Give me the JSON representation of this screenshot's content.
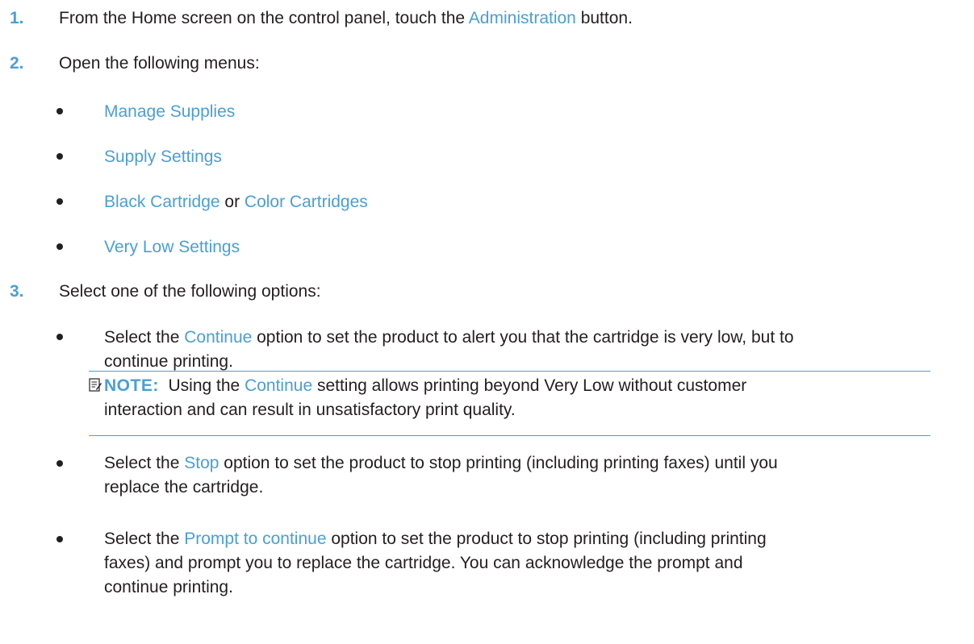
{
  "colors": {
    "accent": "#4a9fd5",
    "text": "#231f20"
  },
  "steps": [
    {
      "number": "1.",
      "text_before": "From the Home screen on the control panel, touch the ",
      "link": "Administration",
      "text_after": " button."
    },
    {
      "number": "2.",
      "text": "Open the following menus:",
      "menus": [
        {
          "label": "Manage Supplies"
        },
        {
          "label": "Supply Settings"
        },
        {
          "label": "Black Cartridge",
          "joiner": " or ",
          "label2": "Color Cartridges"
        },
        {
          "label": "Very Low Settings"
        }
      ]
    },
    {
      "number": "3.",
      "text": "Select one of the following options:",
      "options": [
        {
          "prefix": "Select the ",
          "link": "Continue",
          "line1_rest": " option to set the product to alert you that the cartridge is very low, but to",
          "line2": "continue printing."
        },
        {
          "prefix": "Select the ",
          "link": "Stop",
          "line1_rest": " option to set the product to stop printing (including printing faxes) until you",
          "line2": "replace the cartridge."
        },
        {
          "prefix": "Select the ",
          "link": "Prompt to continue",
          "line1_rest": " option to set the product to stop printing (including printing",
          "line2": "faxes) and prompt you to replace the cartridge. You can acknowledge the prompt and",
          "line3": "continue printing."
        }
      ]
    }
  ],
  "note": {
    "icon": "note-icon",
    "label": "NOTE:",
    "prefix": "Using the ",
    "link": "Continue",
    "line1_rest": " setting allows printing beyond Very Low without customer",
    "line2": "interaction and can result in unsatisfactory print quality."
  }
}
